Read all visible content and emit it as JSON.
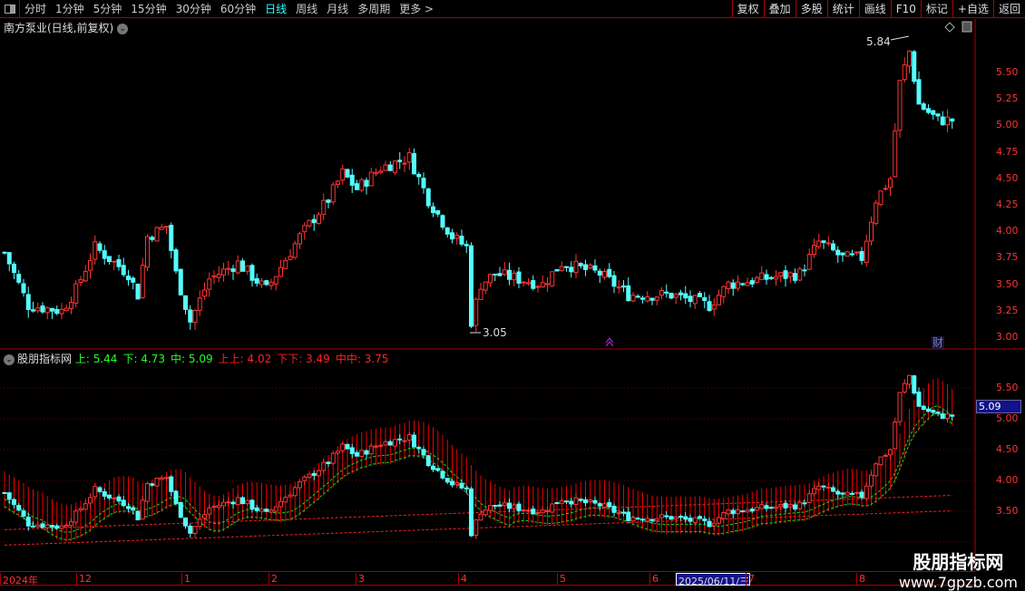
{
  "toolbar": {
    "periods": [
      "分时",
      "1分钟",
      "5分钟",
      "15分钟",
      "30分钟",
      "60分钟",
      "日线",
      "周线",
      "月线",
      "多周期",
      "更多 >"
    ],
    "active": "日线",
    "right": [
      "复权",
      "叠加",
      "多股",
      "统计",
      "画线",
      "F10",
      "标记",
      "+自选",
      "返回"
    ]
  },
  "main": {
    "title": "南方泵业(日线,前复权)",
    "high_label": "5.84",
    "low_label": "3.05",
    "fin_badge": "财",
    "yticks": [
      "5.50",
      "5.25",
      "5.00",
      "4.75",
      "4.50",
      "4.25",
      "4.00",
      "3.75",
      "3.50",
      "3.25",
      "3.00"
    ]
  },
  "indicator": {
    "name": "股朋指标网",
    "items": [
      {
        "k": "上:",
        "v": "5.44",
        "c": "g"
      },
      {
        "k": "下:",
        "v": "4.73",
        "c": "g"
      },
      {
        "k": "中:",
        "v": "5.09",
        "c": "g"
      },
      {
        "k": "上上:",
        "v": "4.02",
        "c": "r"
      },
      {
        "k": "下下:",
        "v": "3.49",
        "c": "r"
      },
      {
        "k": "中中:",
        "v": "3.75",
        "c": "r"
      }
    ],
    "yticks": [
      "5.50",
      "5.00",
      "4.50",
      "4.00",
      "3.50",
      "3.00"
    ],
    "current": "5.09"
  },
  "dates": [
    "2024年",
    "12",
    "1",
    "2",
    "3",
    "4",
    "5",
    "6",
    "2025/06/11/三",
    "7",
    "8"
  ],
  "watermark": {
    "name": "股朋指标网",
    "url": "www.7gpzb.com"
  },
  "chart_data": {
    "type": "candlestick",
    "price_path": [
      [
        0,
        3.8
      ],
      [
        5,
        3.3
      ],
      [
        12,
        3.25
      ],
      [
        15,
        3.45
      ],
      [
        19,
        3.85
      ],
      [
        26,
        3.6
      ],
      [
        28,
        3.4
      ],
      [
        30,
        3.95
      ],
      [
        34,
        4.05
      ],
      [
        36,
        3.6
      ],
      [
        39,
        3.15
      ],
      [
        43,
        3.55
      ],
      [
        49,
        3.7
      ],
      [
        55,
        3.45
      ],
      [
        62,
        3.95
      ],
      [
        68,
        4.3
      ],
      [
        71,
        4.55
      ],
      [
        74,
        4.4
      ],
      [
        79,
        4.6
      ],
      [
        85,
        4.7
      ],
      [
        89,
        4.3
      ],
      [
        94,
        3.95
      ],
      [
        97,
        3.85
      ],
      [
        98,
        3.15
      ],
      [
        100,
        3.5
      ],
      [
        103,
        3.6
      ],
      [
        113,
        3.5
      ],
      [
        117,
        3.7
      ],
      [
        125,
        3.6
      ],
      [
        131,
        3.4
      ],
      [
        140,
        3.4
      ],
      [
        148,
        3.3
      ],
      [
        152,
        3.5
      ],
      [
        159,
        3.55
      ],
      [
        167,
        3.6
      ],
      [
        171,
        3.9
      ],
      [
        176,
        3.75
      ],
      [
        180,
        3.75
      ],
      [
        183,
        4.3
      ],
      [
        186,
        4.5
      ],
      [
        188,
        5.4
      ],
      [
        190,
        5.7
      ],
      [
        192,
        5.2
      ],
      [
        196,
        5.05
      ],
      [
        200,
        5.05
      ]
    ],
    "high": 5.84,
    "low": 3.05
  }
}
